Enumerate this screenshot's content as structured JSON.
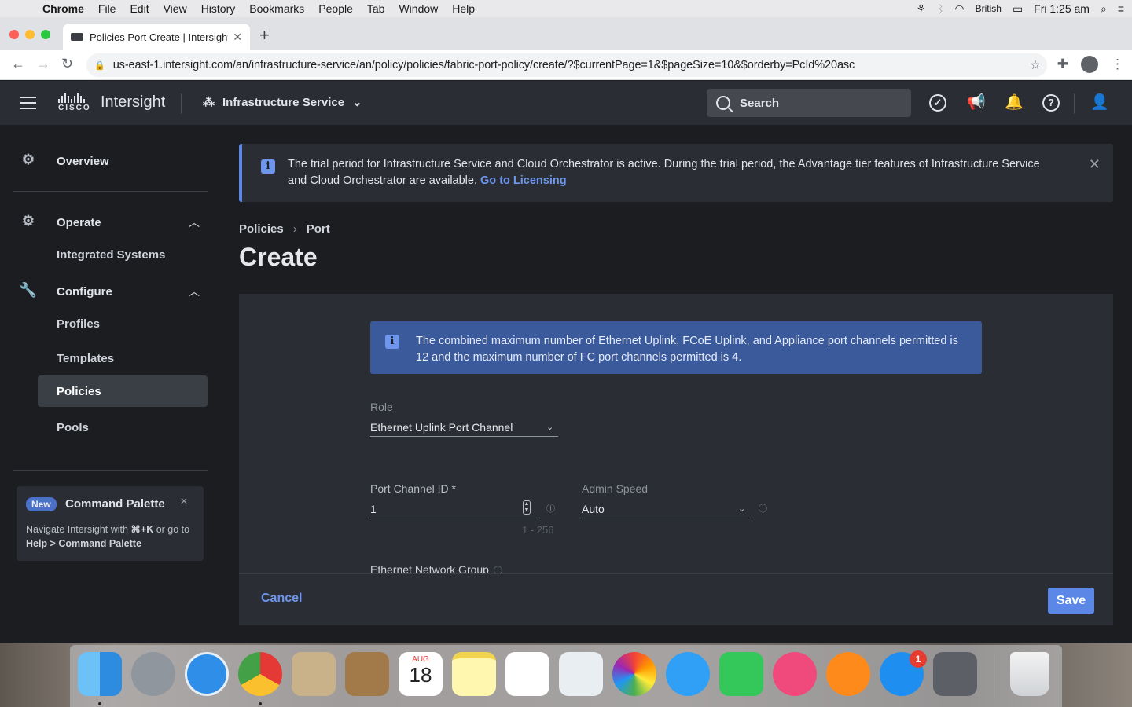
{
  "mac_menubar": {
    "app": "Chrome",
    "items": [
      "File",
      "Edit",
      "View",
      "History",
      "Bookmarks",
      "People",
      "Tab",
      "Window",
      "Help"
    ],
    "input_source": "British",
    "clock": "Fri 1:25 am"
  },
  "browser": {
    "tab_title": "Policies Port Create | Intersight",
    "url": "us-east-1.intersight.com/an/infrastructure-service/an/policy/policies/fabric-port-policy/create/?$currentPage=1&$pageSize=10&$orderby=PcId%20asc"
  },
  "header": {
    "brand": "Intersight",
    "cisco_word": "CISCO",
    "service": "Infrastructure Service",
    "search_placeholder": "Search"
  },
  "sidebar": {
    "overview": "Overview",
    "operate": "Operate",
    "integrated_systems": "Integrated Systems",
    "configure": "Configure",
    "profiles": "Profiles",
    "templates": "Templates",
    "policies": "Policies",
    "pools": "Pools",
    "command_palette": {
      "badge": "New",
      "title": "Command Palette",
      "body_prefix": "Navigate Intersight with ",
      "shortcut": "⌘+K",
      "body_mid": " or go to ",
      "path": "Help > Command Palette"
    }
  },
  "banner": {
    "text": "The trial period for Infrastructure Service and Cloud Orchestrator is active. During the trial period, the Advantage tier features of Infrastructure Service and Cloud Orchestrator are available.",
    "link": "Go to Licensing"
  },
  "breadcrumb": {
    "first": "Policies",
    "second": "Port"
  },
  "page_title": "Create",
  "form": {
    "note": "The combined maximum number of Ethernet Uplink, FCoE Uplink, and Appliance port channels permitted is 12 and the maximum number of FC port channels permitted is 4.",
    "role_label": "Role",
    "role_value": "Ethernet Uplink Port Channel",
    "port_channel_label": "Port Channel ID *",
    "port_channel_value": "1",
    "port_channel_range": "1 - 256",
    "admin_speed_label": "Admin Speed",
    "admin_speed_value": "Auto",
    "eth_network_group_label": "Ethernet Network Group"
  },
  "footer": {
    "cancel": "Cancel",
    "save": "Save"
  },
  "dock": {
    "calendar_month": "AUG",
    "calendar_day": "18",
    "appstore_badge": "1"
  }
}
